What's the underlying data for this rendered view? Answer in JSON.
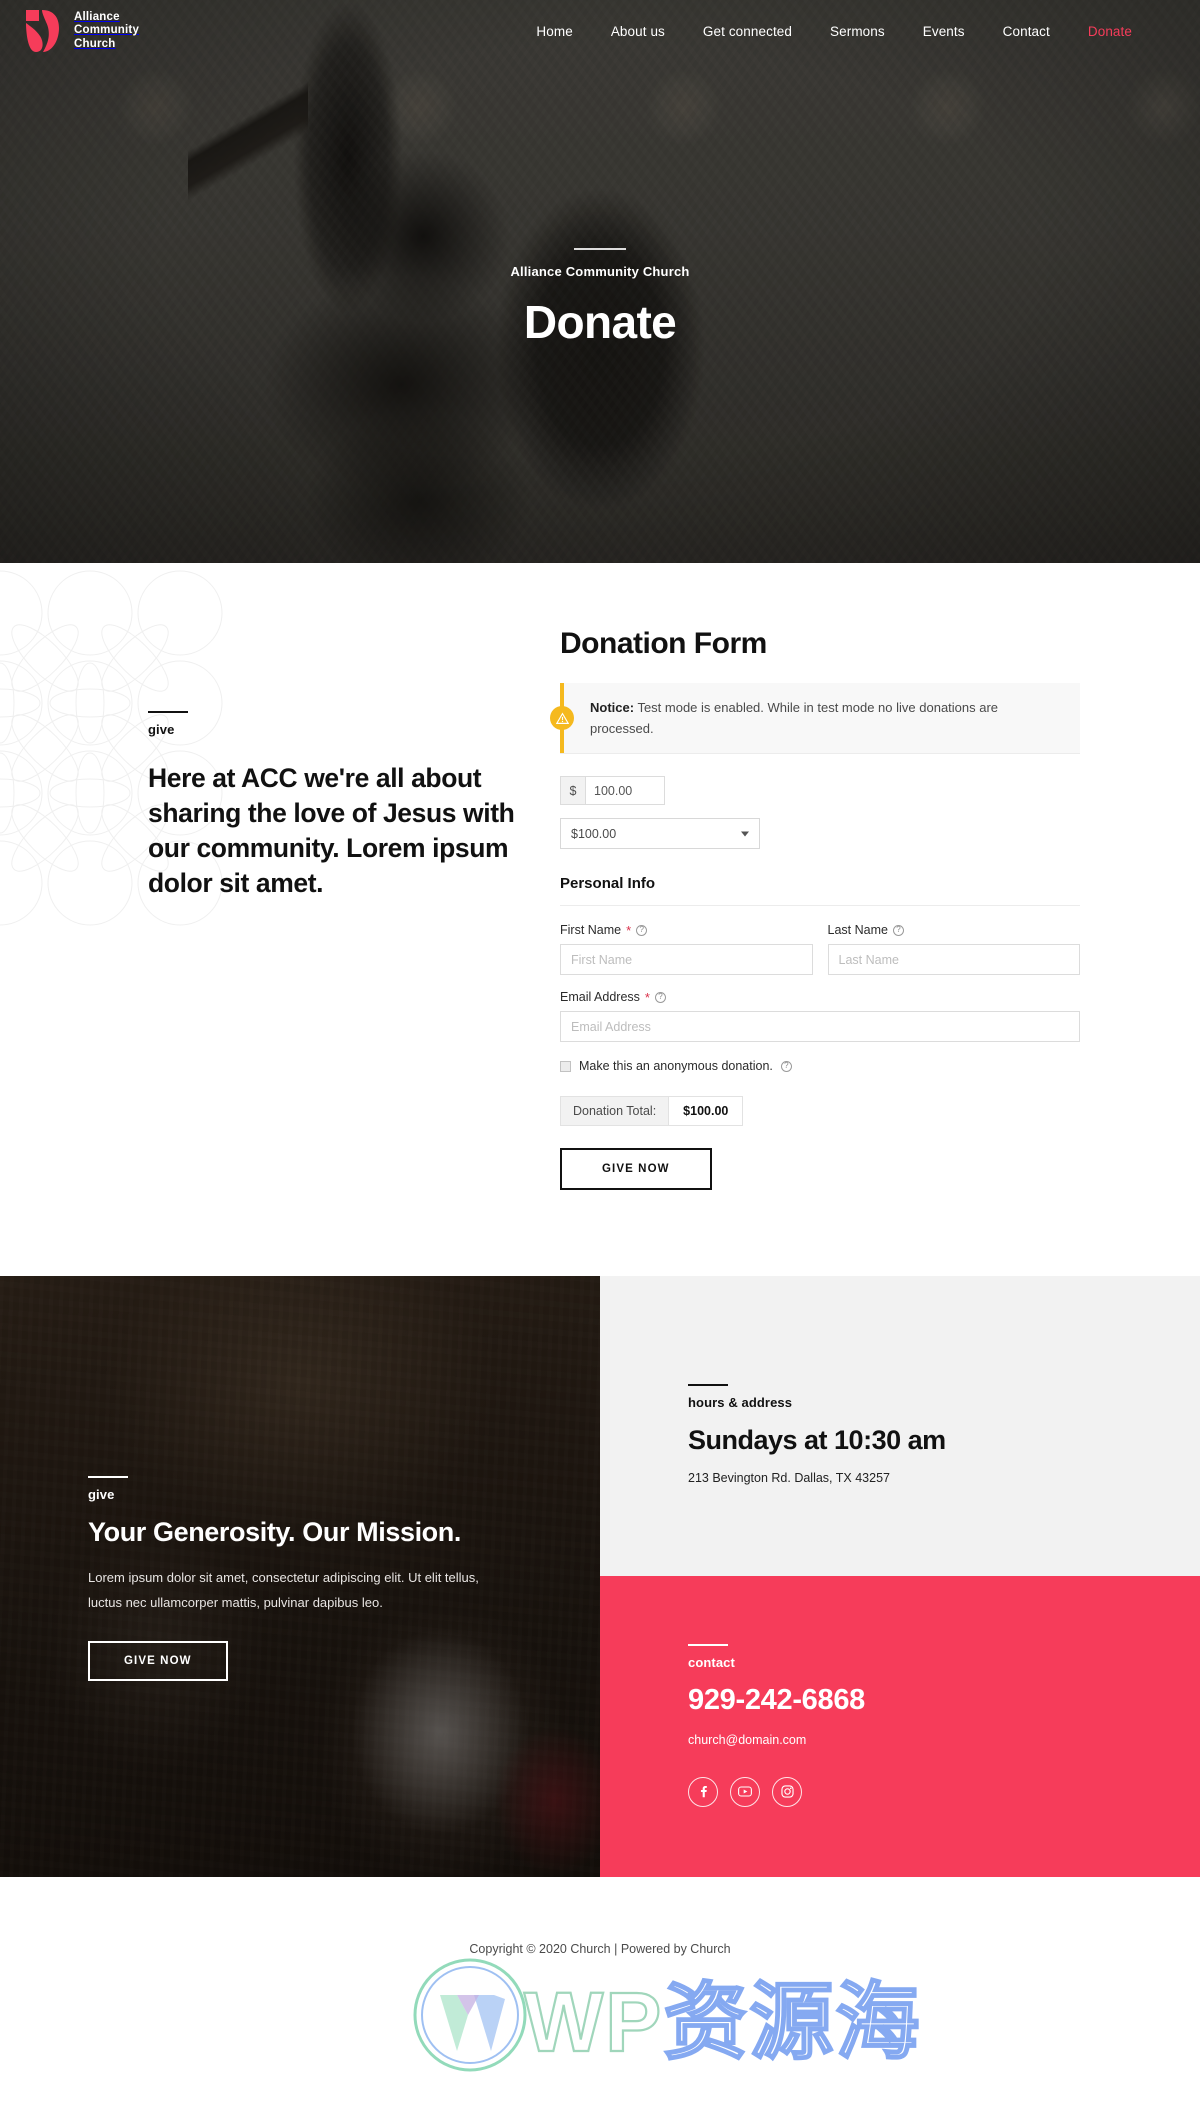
{
  "brand": {
    "name_lines": "Alliance\nCommunity\nChurch",
    "logo_icon": "church-logo-icon",
    "accent_color": "#f63c5a"
  },
  "nav": {
    "items": [
      {
        "label": "Home",
        "accent": false
      },
      {
        "label": "About us",
        "accent": false
      },
      {
        "label": "Get connected",
        "accent": false
      },
      {
        "label": "Sermons",
        "accent": false
      },
      {
        "label": "Events",
        "accent": false
      },
      {
        "label": "Contact",
        "accent": false
      },
      {
        "label": "Donate",
        "accent": true
      }
    ]
  },
  "hero": {
    "eyebrow": "Alliance Community Church",
    "title": "Donate"
  },
  "donate": {
    "left": {
      "eyebrow": "give",
      "lead": "Here at ACC we're all about sharing the love of Jesus with our community. Lorem ipsum dolor sit amet."
    },
    "form": {
      "title": "Donation Form",
      "notice_label": "Notice:",
      "notice_text": " Test mode is enabled. While in test mode no live donations are processed.",
      "notice_icon": "warning-icon",
      "currency_symbol": "$",
      "amount_value": "100.00",
      "amount_placeholder": "100.00",
      "preset_selected": "$100.00",
      "preset_options": [
        "$100.00"
      ],
      "personal_info_heading": "Personal Info",
      "first_name_label": "First Name",
      "first_name_required": "*",
      "first_name_placeholder": "First Name",
      "last_name_label": "Last Name",
      "last_name_placeholder": "Last Name",
      "email_label": "Email Address",
      "email_required": "*",
      "email_placeholder": "Email Address",
      "anonymous_label": "Make this an anonymous donation.",
      "total_label": "Donation Total:",
      "total_value": "$100.00",
      "submit_label": "GIVE NOW",
      "help_icon": "question-circle-icon"
    }
  },
  "generosity": {
    "eyebrow": "give",
    "heading": "Your Generosity. Our Mission.",
    "body": "Lorem ipsum dolor sit amet, consectetur adipiscing elit. Ut elit tellus, luctus nec ullamcorper mattis, pulvinar dapibus leo.",
    "button_label": "GIVE NOW"
  },
  "hours": {
    "eyebrow": "hours & address",
    "heading": "Sundays at 10:30 am",
    "address": "213 Bevington Rd. Dallas, TX 43257",
    "background_color": "#f2f2f2"
  },
  "contact": {
    "eyebrow": "contact",
    "phone": "929-242-6868",
    "email": "church@domain.com",
    "background_color": "#f63c5a",
    "socials": [
      {
        "name": "facebook-icon",
        "glyph": "f"
      },
      {
        "name": "youtube-icon",
        "glyph": "▶"
      },
      {
        "name": "instagram-icon",
        "glyph": "▣"
      }
    ]
  },
  "footer": {
    "copyright": "Copyright © 2020 Church | Powered by Church"
  },
  "watermark": {
    "wp": "WP",
    "cn": "资源海",
    "logo_icon": "wordpress-logo-icon"
  }
}
